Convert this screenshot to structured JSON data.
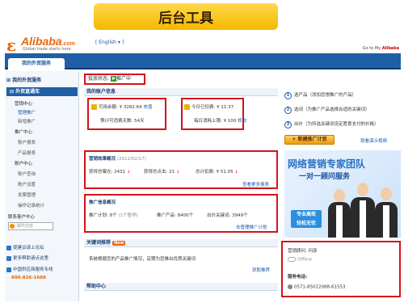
{
  "banner": {
    "title": "后台工具"
  },
  "header": {
    "logo": "Alibaba",
    "logo_suffix": ".com",
    "slogan": "Global trade starts here.",
    "language": "English",
    "goto_text": "Go to My",
    "goto_brand": "Alibaba"
  },
  "tabs": [
    {
      "label": "我的外贸服务"
    }
  ],
  "sidebar": {
    "sec1": "我的外贸服务",
    "sec2": "外贸直通车",
    "groups": [
      {
        "label": "营销中心",
        "items": [
          "管理推广",
          "新增推广"
        ]
      },
      {
        "label": "推广中心",
        "items": [
          "账户报表",
          "产品报表"
        ]
      },
      {
        "label": "账户中心",
        "items": [
          "账户查询",
          "账户设置",
          "发票管理",
          "操作记录统计"
        ]
      }
    ],
    "contact_label": "联系客户中心",
    "ww_placeholder": "邮件内容",
    "links": [
      "提建议请上论坛",
      "更多帮助请点这里",
      "中国供应商服务专线"
    ],
    "hotline": "800-826-1688"
  },
  "main": {
    "status_label": "投放状态:",
    "status_value": "推广中",
    "account": {
      "title": "我的账户信息",
      "balance_label": "可用余额:",
      "balance_value": "¥ 3282.64",
      "recharge": "充值",
      "days_text": "预计可消费天数: 54天",
      "today_label": "今日已扣费:",
      "today_value": "¥ 11.37",
      "limit_label": "每日消耗上限:",
      "limit_value": "¥ 100",
      "modify": "修改"
    },
    "marketing": {
      "title": "营销效果概况",
      "date": "(2012/02/17)",
      "exposure_label": "获得总曝光:",
      "exposure_value": "2431",
      "clicks_label": "获得总点击:",
      "clicks_value": "21",
      "spend_label": "总计扣费:",
      "spend_value": "¥ 51.05",
      "more": "查看更多报表"
    },
    "promo": {
      "title": "推广信息概况",
      "plan_label": "推广计划:",
      "plan_value": "8个",
      "plan_paused": "(1个暂停)",
      "products_label": "推广产品:",
      "products_value": "8400个",
      "keywords_label": "出价关键词:",
      "keywords_value": "3949个",
      "manage": "去管理推广计划"
    },
    "keyword": {
      "title": "关键词推荐",
      "badge": "New",
      "text": "系统根据您的产品推广情况，定期为您推出优质关键词",
      "link": "获取推荐"
    },
    "help": {
      "title": "帮助中心"
    }
  },
  "right": {
    "steps": [
      {
        "num": "1",
        "text": "选产品（添加您想推广的产品）"
      },
      {
        "num": "2",
        "text": "选词（为推广产品选择合适的关键词）"
      },
      {
        "num": "3",
        "text": "出价（为所选关键词设定愿意支付的价格）"
      }
    ],
    "new_plan": "新建推广计划",
    "demo": "观看演示视频",
    "ad_title": "网络营销专家团队",
    "ad_sub": "一对一顾问服务",
    "ad_badge_1": "专业高效",
    "ad_badge_2": "轻松无忧",
    "consultant_label": "营销顾问:",
    "consultant_name": "何彦",
    "online_status": "Offline",
    "phone_label": "服务电话:",
    "phone": "0571-85022088-61553"
  },
  "colors": {
    "accent": "#1f5fa6",
    "highlight": "#d4131b",
    "brand": "#e8660c"
  }
}
